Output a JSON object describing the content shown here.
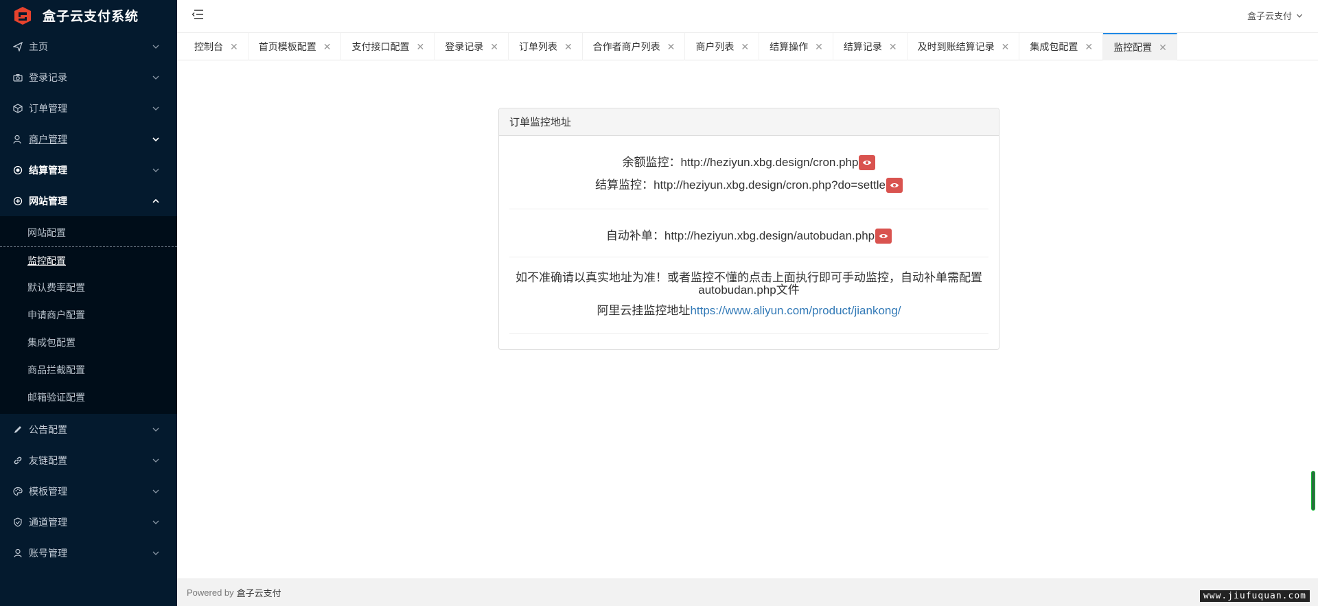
{
  "app": {
    "title": "盒子云支付系统",
    "accent": "#1e88e5",
    "logo_color": "#e8432d"
  },
  "header": {
    "user_label": "盒子云支付"
  },
  "sidebar": {
    "items": [
      {
        "label": "主页",
        "icon": "send-icon"
      },
      {
        "label": "登录记录",
        "icon": "camera-icon"
      },
      {
        "label": "订单管理",
        "icon": "box-icon"
      },
      {
        "label": "商户管理",
        "icon": "user-icon"
      },
      {
        "label": "结算管理",
        "icon": "radio-icon"
      },
      {
        "label": "网站管理",
        "icon": "plus-circle-icon"
      }
    ],
    "sub_items": [
      {
        "label": "网站配置"
      },
      {
        "label": "监控配置"
      },
      {
        "label": "默认费率配置"
      },
      {
        "label": "申请商户配置"
      },
      {
        "label": "集成包配置"
      },
      {
        "label": "商品拦截配置"
      },
      {
        "label": "邮箱验证配置"
      }
    ],
    "items_after": [
      {
        "label": "公告配置",
        "icon": "pencil-icon"
      },
      {
        "label": "友链配置",
        "icon": "link-icon"
      },
      {
        "label": "模板管理",
        "icon": "palette-icon"
      },
      {
        "label": "通道管理",
        "icon": "shield-check-icon"
      },
      {
        "label": "账号管理",
        "icon": "person-icon"
      }
    ]
  },
  "tabs": [
    {
      "label": "控制台"
    },
    {
      "label": "首页模板配置"
    },
    {
      "label": "支付接口配置"
    },
    {
      "label": "登录记录"
    },
    {
      "label": "订单列表"
    },
    {
      "label": "合作者商户列表"
    },
    {
      "label": "商户列表"
    },
    {
      "label": "结算操作"
    },
    {
      "label": "结算记录"
    },
    {
      "label": "及时到账结算记录"
    },
    {
      "label": "集成包配置"
    },
    {
      "label": "监控配置"
    }
  ],
  "tab_close": "✕",
  "panel": {
    "heading": "订单监控地址",
    "balance_label": "余额监控：",
    "balance_url": "http://heziyun.xbg.design/cron.php",
    "settle_label": "结算监控：",
    "settle_url": "http://heziyun.xbg.design/cron.php?do=settle",
    "autobudan_label": "自动补单：",
    "autobudan_url": "http://heziyun.xbg.design/autobudan.php",
    "note": "如不准确请以真实地址为准！或者监控不懂的点击上面执行即可手动监控，自动补单需配置autobudan.php文件",
    "aliyun_label": "阿里云挂监控地址",
    "aliyun_url": "https://www.aliyun.com/product/jiankong/"
  },
  "footer": {
    "powered": "Powered by",
    "brand": "盒子云支付"
  },
  "watermark": "www.jiufuquan.com"
}
